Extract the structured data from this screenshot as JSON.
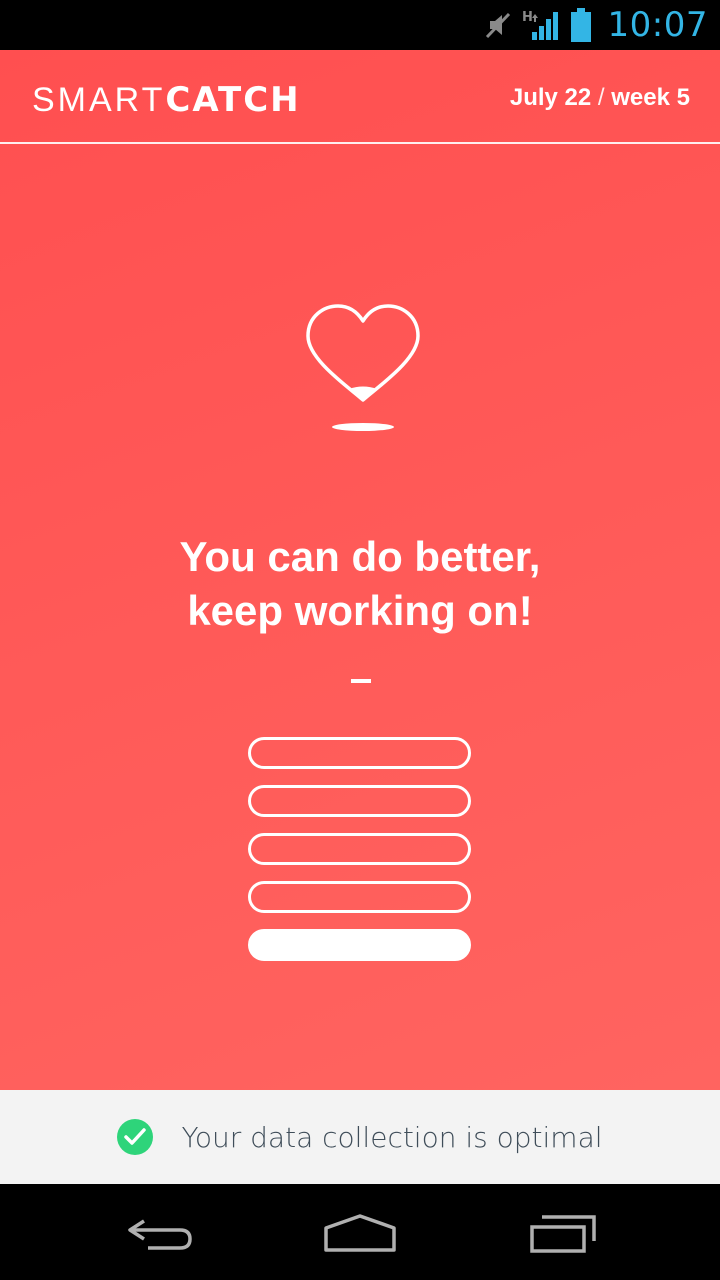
{
  "status_bar": {
    "time": "10:07",
    "network_type": "H",
    "icons": [
      "mute-icon",
      "signal-icon",
      "battery-icon"
    ],
    "accent_color": "#33b5e5"
  },
  "header": {
    "logo_light": "SMART",
    "logo_bold": "CATCH",
    "date": "July 22",
    "separator": "/",
    "week": "week 5"
  },
  "main": {
    "icon": "heart-icon",
    "headline_line1": "You can do better,",
    "headline_line2": "keep working on!",
    "level_bars": [
      {
        "filled": false
      },
      {
        "filled": false
      },
      {
        "filled": false
      },
      {
        "filled": false
      },
      {
        "filled": true
      }
    ],
    "level_filled_count": 1,
    "level_total": 5,
    "background_color": "#ff5555"
  },
  "info_bar": {
    "icon": "check-circle-icon",
    "text": "Your data collection is optimal",
    "check_color": "#2ed47a"
  },
  "nav_bar": {
    "buttons": [
      "back-icon",
      "home-icon",
      "recent-apps-icon"
    ]
  }
}
